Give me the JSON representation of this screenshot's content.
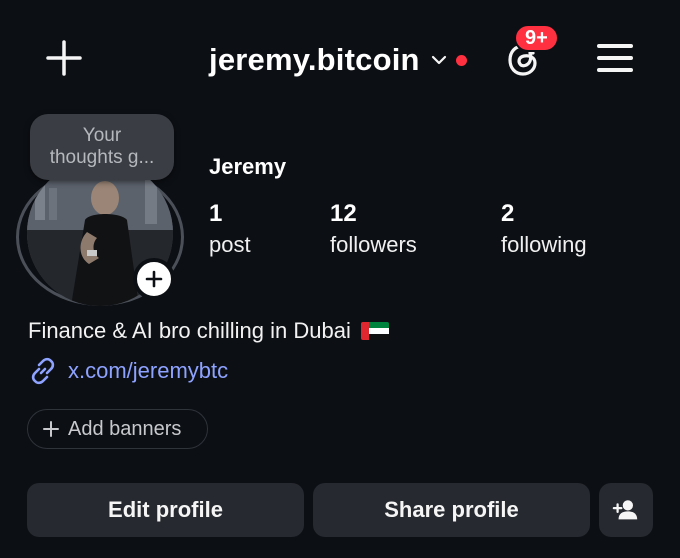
{
  "header": {
    "username": "jeremy.bitcoin",
    "notification_badge": "9+",
    "accent_red": "#ff3040"
  },
  "note": {
    "line1": "Your",
    "line2": "thoughts g..."
  },
  "profile": {
    "display_name": "Jeremy",
    "stats": [
      {
        "value": "1",
        "label": "post"
      },
      {
        "value": "12",
        "label": "followers"
      },
      {
        "value": "2",
        "label": "following"
      }
    ],
    "bio": "Finance & AI bro chilling in Dubai",
    "link": "x.com/jeremybtc",
    "link_color": "#8ea2ff"
  },
  "actions": {
    "add_banners": "Add banners",
    "edit_profile": "Edit profile",
    "share_profile": "Share profile"
  },
  "icons": {
    "new_post": "plus-icon",
    "switch_account": "chevron-down-icon",
    "threads": "threads-icon",
    "menu": "hamburger-menu-icon",
    "add_story": "plus-icon",
    "link": "link-icon",
    "flag": "uae-flag-icon",
    "discover_people": "add-person-icon"
  }
}
